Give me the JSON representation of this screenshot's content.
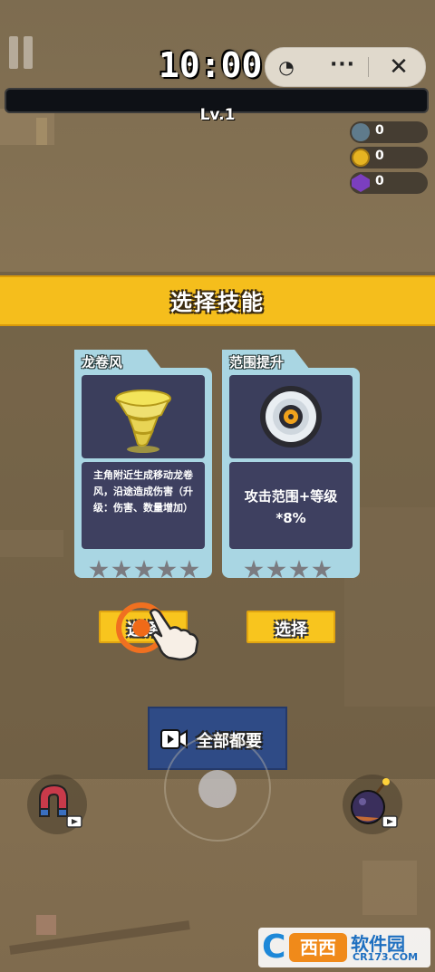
{
  "hud": {
    "timer": "10:00",
    "level": "Lv.1",
    "resources": [
      {
        "icon": "skull-icon",
        "value": "0",
        "color": "#6f8a9b"
      },
      {
        "icon": "coin-icon",
        "value": "0",
        "color": "#e6b422"
      },
      {
        "icon": "gem-icon",
        "value": "0",
        "color": "#7b3fbf"
      }
    ],
    "wechat": {
      "more": "···",
      "close": "✕"
    }
  },
  "dialog": {
    "title": "选择技能",
    "cards": [
      {
        "name": "龙卷风",
        "icon": "tornado-icon",
        "desc": "主角附近生成移动龙卷风，沿途造成伤害（升级：伤害、数量增加）",
        "stars": 5
      },
      {
        "name": "范围提升",
        "icon": "range-ring-icon",
        "desc": "攻击范围+等级*8%",
        "stars": 4
      }
    ],
    "select_label": "选择",
    "watch_all_label": "全部都要"
  },
  "watermark": {
    "brand_box": "西西",
    "name": "软件园",
    "url": "CR173.COM",
    "letter": "C"
  }
}
